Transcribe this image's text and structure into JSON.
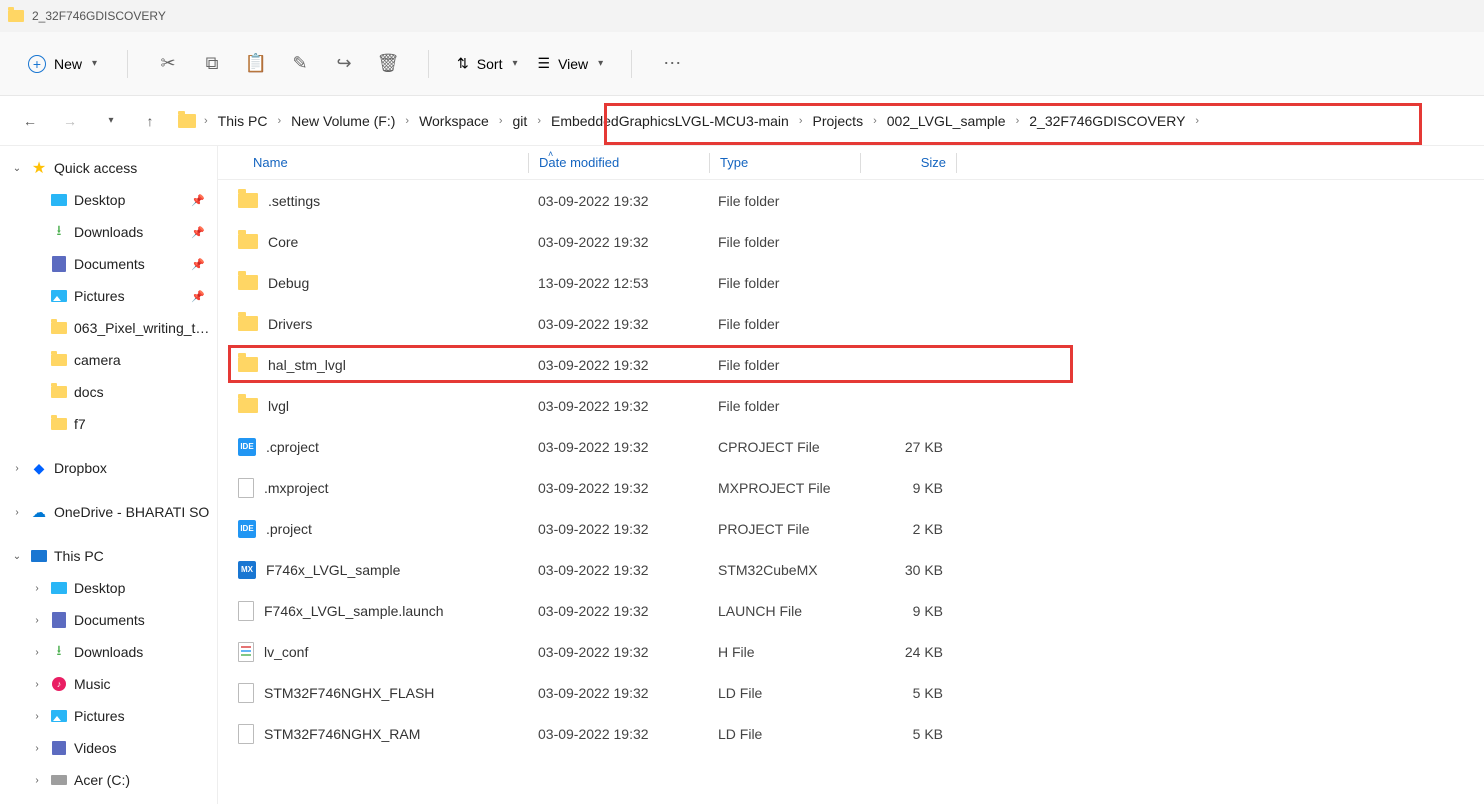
{
  "window": {
    "title": "2_32F746GDISCOVERY"
  },
  "toolbar": {
    "new_label": "New",
    "sort_label": "Sort",
    "view_label": "View"
  },
  "breadcrumb": [
    {
      "label": "This PC"
    },
    {
      "label": "New Volume (F:)"
    },
    {
      "label": "Workspace"
    },
    {
      "label": "git"
    },
    {
      "label": "EmbeddedGraphicsLVGL-MCU3-main"
    },
    {
      "label": "Projects"
    },
    {
      "label": "002_LVGL_sample"
    },
    {
      "label": "2_32F746GDISCOVERY"
    }
  ],
  "sidebar": {
    "quick_access": "Quick access",
    "desktop": "Desktop",
    "downloads": "Downloads",
    "documents": "Documents",
    "pictures": "Pictures",
    "pixel": "063_Pixel_writing_to_d",
    "camera": "camera",
    "docs": "docs",
    "f7": "f7",
    "dropbox": "Dropbox",
    "onedrive": "OneDrive - BHARATI SO",
    "this_pc": "This PC",
    "pc_desktop": "Desktop",
    "pc_documents": "Documents",
    "pc_downloads": "Downloads",
    "pc_music": "Music",
    "pc_pictures": "Pictures",
    "pc_videos": "Videos",
    "acer": "Acer (C:)"
  },
  "columns": {
    "name": "Name",
    "date": "Date modified",
    "type": "Type",
    "size": "Size"
  },
  "files": [
    {
      "icon": "folder",
      "name": ".settings",
      "date": "03-09-2022 19:32",
      "type": "File folder",
      "size": ""
    },
    {
      "icon": "folder",
      "name": "Core",
      "date": "03-09-2022 19:32",
      "type": "File folder",
      "size": ""
    },
    {
      "icon": "folder",
      "name": "Debug",
      "date": "13-09-2022 12:53",
      "type": "File folder",
      "size": ""
    },
    {
      "icon": "folder",
      "name": "Drivers",
      "date": "03-09-2022 19:32",
      "type": "File folder",
      "size": ""
    },
    {
      "icon": "folder",
      "name": "hal_stm_lvgl",
      "date": "03-09-2022 19:32",
      "type": "File folder",
      "size": "",
      "highlighted": true
    },
    {
      "icon": "folder",
      "name": "lvgl",
      "date": "03-09-2022 19:32",
      "type": "File folder",
      "size": ""
    },
    {
      "icon": "ide",
      "name": ".cproject",
      "date": "03-09-2022 19:32",
      "type": "CPROJECT File",
      "size": "27 KB"
    },
    {
      "icon": "file",
      "name": ".mxproject",
      "date": "03-09-2022 19:32",
      "type": "MXPROJECT File",
      "size": "9 KB"
    },
    {
      "icon": "ide",
      "name": ".project",
      "date": "03-09-2022 19:32",
      "type": "PROJECT File",
      "size": "2 KB"
    },
    {
      "icon": "mx",
      "name": "F746x_LVGL_sample",
      "date": "03-09-2022 19:32",
      "type": "STM32CubeMX",
      "size": "30 KB"
    },
    {
      "icon": "file",
      "name": "F746x_LVGL_sample.launch",
      "date": "03-09-2022 19:32",
      "type": "LAUNCH File",
      "size": "9 KB"
    },
    {
      "icon": "text",
      "name": "lv_conf",
      "date": "03-09-2022 19:32",
      "type": "H File",
      "size": "24 KB"
    },
    {
      "icon": "file",
      "name": "STM32F746NGHX_FLASH",
      "date": "03-09-2022 19:32",
      "type": "LD File",
      "size": "5 KB"
    },
    {
      "icon": "file",
      "name": "STM32F746NGHX_RAM",
      "date": "03-09-2022 19:32",
      "type": "LD File",
      "size": "5 KB"
    }
  ]
}
